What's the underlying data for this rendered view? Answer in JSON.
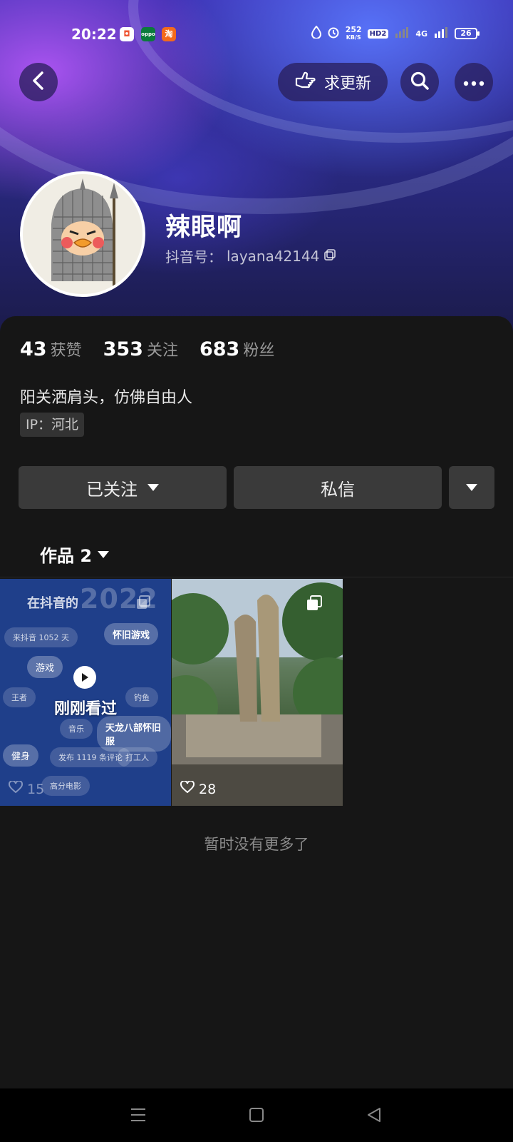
{
  "status_bar": {
    "time": "20:22",
    "speed_value": "252",
    "speed_unit": "KB/S",
    "hd": "HD2",
    "network": "4G",
    "battery": "26"
  },
  "header": {
    "update_label": "求更新"
  },
  "profile": {
    "nickname": "辣眼啊",
    "id_label": "抖音号：",
    "id_value": "layana42144"
  },
  "stats": [
    {
      "num": "43",
      "label": "获赞"
    },
    {
      "num": "353",
      "label": "关注"
    },
    {
      "num": "683",
      "label": "粉丝"
    }
  ],
  "bio": "阳关洒肩头，仿佛自由人",
  "ip": "IP：河北",
  "actions": {
    "follow_label": "已关注",
    "message_label": "私信"
  },
  "works": {
    "tab_label": "作品 2",
    "items": [
      {
        "likes": "15",
        "overlay": "刚刚看过",
        "header_text": "在抖音的",
        "year": "2022",
        "tags": [
          "来抖音 1052 天",
          "怀旧游戏",
          "游戏",
          "王者",
          "钓鱼",
          "音乐",
          "天龙八部怀旧服",
          "健身",
          "发布 1119 条评论",
          "高分电影",
          "打工人"
        ]
      },
      {
        "likes": "28"
      }
    ],
    "end_text": "暂时没有更多了"
  },
  "colors": {
    "background": "#161616",
    "button": "#3a3a3a",
    "hero": "#2a2a86"
  }
}
